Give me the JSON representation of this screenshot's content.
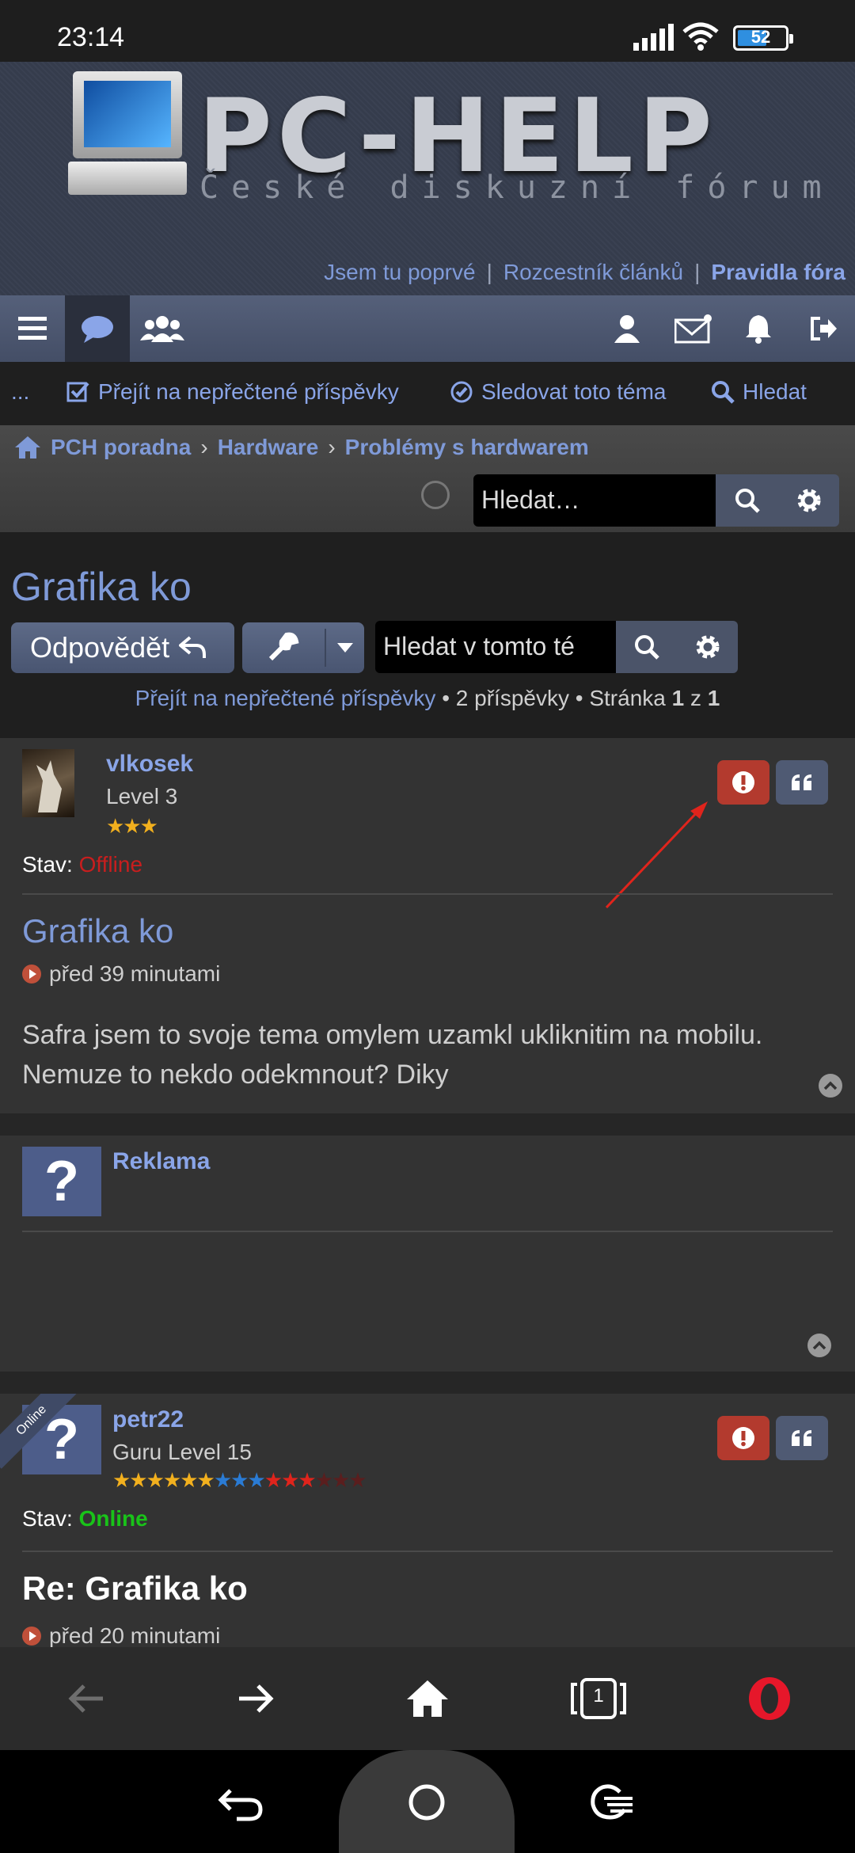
{
  "status_bar": {
    "time": "23:14",
    "battery": "52"
  },
  "banner": {
    "title": "PC-HELP",
    "subtitle": "České diskuzní fórum",
    "links": [
      "Jsem tu poprvé",
      "Rozcestník článků",
      "Pravidla fóra"
    ]
  },
  "action_bar": {
    "more": "...",
    "unread": "Přejít na nepřečtené příspěvky",
    "watch": "Sledovat toto téma",
    "search": "Hledat"
  },
  "breadcrumb": [
    "PCH poradna",
    "Hardware",
    "Problémy s hardwarem"
  ],
  "header_search": {
    "placeholder": "Hledat…"
  },
  "topic": {
    "title": "Grafika ko",
    "reply_label": "Odpovědět",
    "search_placeholder": "Hledat v tomto té",
    "pager": {
      "unread": "Přejít na nepřečtené příspěvky",
      "posts": "2 příspěvky",
      "page_prefix": "Stránka",
      "page": "1",
      "of": "z",
      "total": "1"
    }
  },
  "posts": [
    {
      "user": "vlkosek",
      "level": "Level 3",
      "stars": "★★★",
      "stav_label": "Stav:",
      "stav": "Offline",
      "title": "Grafika ko",
      "time": "před 39 minutami",
      "body": "Safra jsem to svoje tema omylem uzamkl ukliknitim na mobilu. Nemuze to nekdo odekmnout? Diky"
    },
    {
      "user": "Reklama"
    },
    {
      "user": "petr22",
      "badge": "Online",
      "level": "Guru Level 15",
      "stars_gold": "★★★★★★",
      "stars_blue": "★★★",
      "stars_red": "★★★",
      "stars_dark": "★★★",
      "stav_label": "Stav:",
      "stav": "Online",
      "title": "Re: Grafika ko",
      "time": "před 20 minutami"
    }
  ],
  "colors": {
    "link": "#8aa5e8",
    "offline": "#c81e1e",
    "online": "#19c319",
    "report": "#b33a2e"
  },
  "browser": {
    "tabs_count": "1"
  }
}
